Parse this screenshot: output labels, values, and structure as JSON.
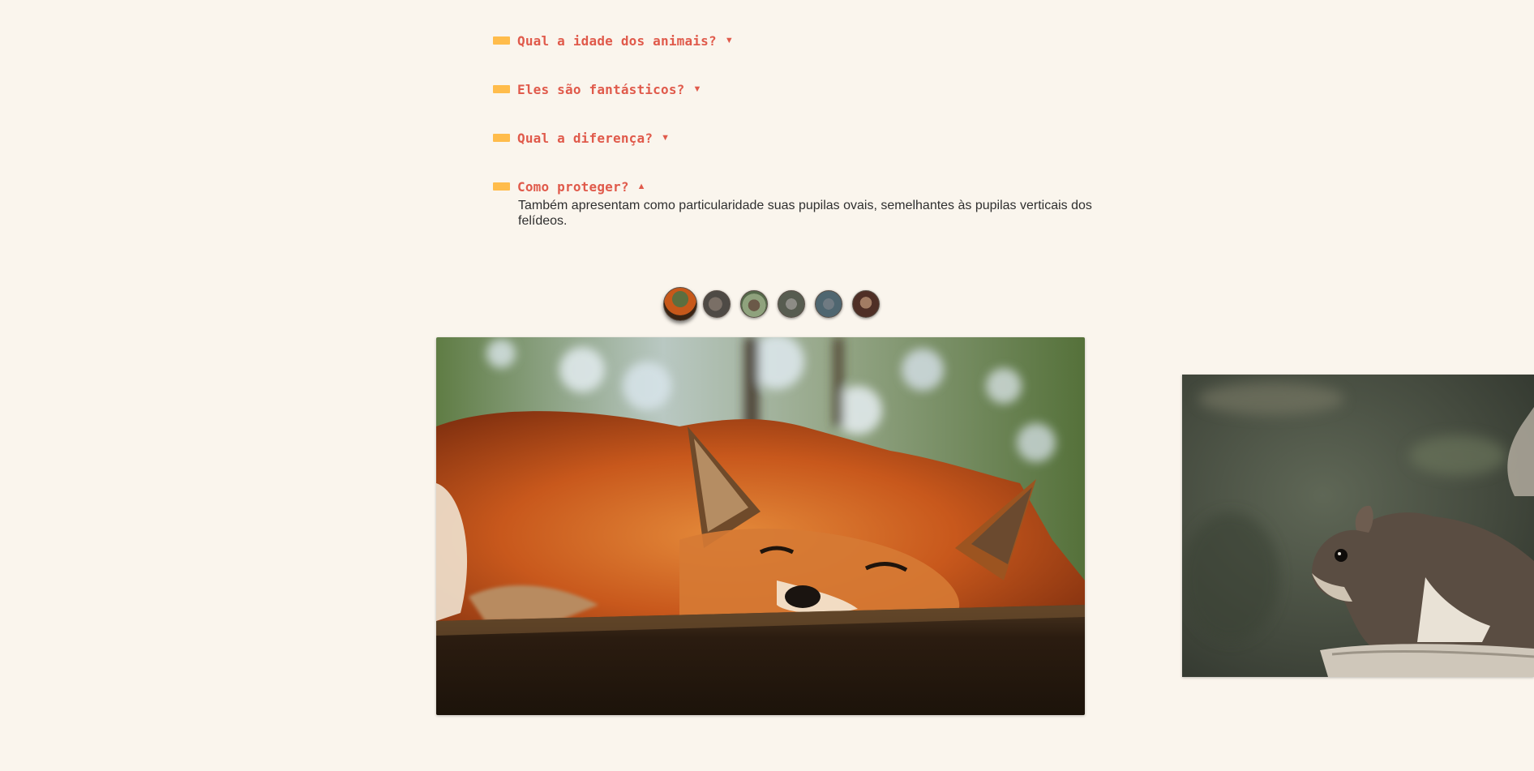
{
  "faq": {
    "items": [
      {
        "question": "Qual a idade dos animais?",
        "arrow": "▼",
        "open": false
      },
      {
        "question": "Eles são fantásticos?",
        "arrow": "▼",
        "open": false
      },
      {
        "question": "Qual a diferença?",
        "arrow": "▼",
        "open": false
      },
      {
        "question": "Como proteger?",
        "arrow": "▲",
        "open": true,
        "answer": "Também apresentam como particularidade suas pupilas ovais, semelhantes às pupilas verticais dos felídeos."
      }
    ]
  },
  "gallery": {
    "thumbnails": [
      {
        "icon": "fox-thumbnail",
        "active": true
      },
      {
        "icon": "squirrel-thumbnail",
        "active": false
      },
      {
        "icon": "bear-thumbnail",
        "active": false
      },
      {
        "icon": "wolf-thumbnail",
        "active": false
      },
      {
        "icon": "owl-thumbnail",
        "active": false
      },
      {
        "icon": "monkey-thumbnail",
        "active": false
      }
    ],
    "current_image": "fox-photo",
    "next_image": "squirrel-photo"
  },
  "colors": {
    "background": "#faf5ed",
    "accent": "#e05a4b",
    "marker": "#ffbc4b"
  }
}
